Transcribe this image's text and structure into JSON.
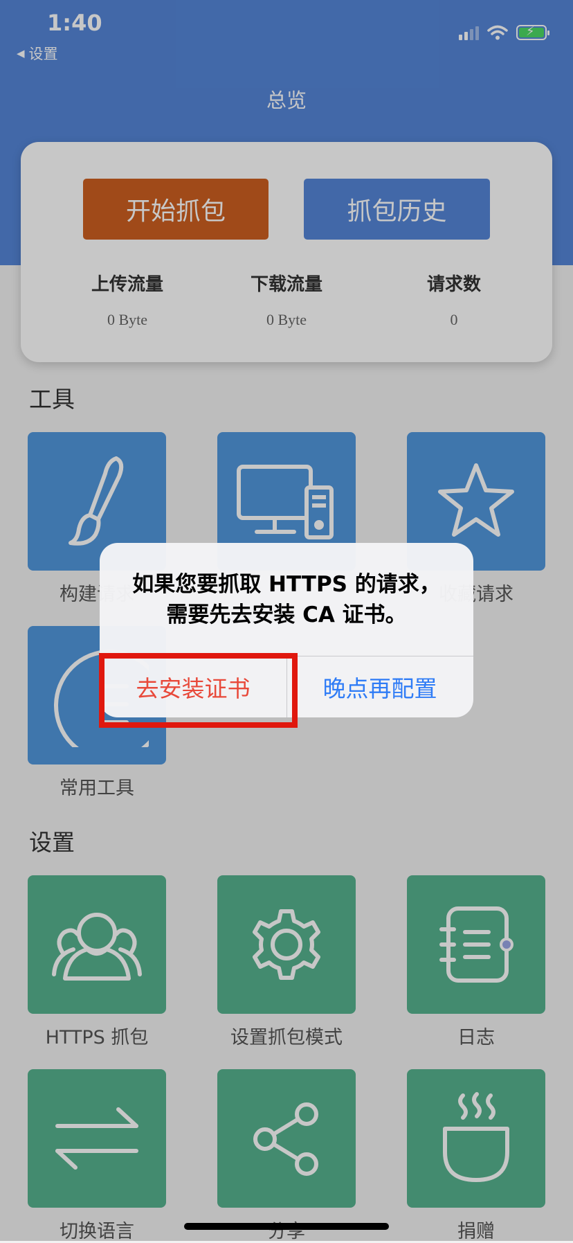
{
  "status_bar": {
    "time": "1:40",
    "back_label": "设置"
  },
  "nav": {
    "title": "总览"
  },
  "overview": {
    "start_button": "开始抓包",
    "history_button": "抓包历史",
    "stats": [
      {
        "label": "上传流量",
        "value": "0 Byte"
      },
      {
        "label": "下载流量",
        "value": "0 Byte"
      },
      {
        "label": "请求数",
        "value": "0"
      }
    ]
  },
  "tools": {
    "title": "工具",
    "items": [
      {
        "label": "构建请求",
        "icon": "brush-icon"
      },
      {
        "label": "",
        "icon": "computer-icon"
      },
      {
        "label": "收藏请求",
        "icon": "star-icon"
      },
      {
        "label": "常用工具",
        "icon": "toolbox-icon"
      }
    ]
  },
  "settings": {
    "title": "设置",
    "items": [
      {
        "label": "HTTPS 抓包",
        "icon": "users-icon"
      },
      {
        "label": "设置抓包模式",
        "icon": "gear-icon"
      },
      {
        "label": "日志",
        "icon": "notebook-icon"
      },
      {
        "label": "切换语言",
        "icon": "swap-arrows-icon"
      },
      {
        "label": "分享",
        "icon": "share-icon"
      },
      {
        "label": "捐赠",
        "icon": "coffee-cup-icon"
      }
    ]
  },
  "alert": {
    "line1": "如果您要抓取 HTTPS 的请求，",
    "line2": "需要先去安装 CA 证书。",
    "install_button": "去安装证书",
    "later_button": "晚点再配置"
  },
  "colors": {
    "header": "#5586d8",
    "start_button": "#ce5f20",
    "tool_tile": "#5198dd",
    "settings_tile": "#57b38f",
    "highlight": "#e0180e",
    "alert_install": "#e8493a",
    "alert_later": "#2f7cf6"
  }
}
